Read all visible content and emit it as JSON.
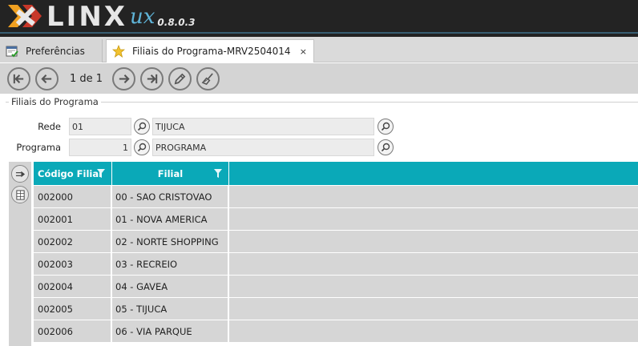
{
  "app": {
    "logo_text": "LINX",
    "logo_suffix": "ux",
    "version": "0.8.0.3"
  },
  "tabs": [
    {
      "label": "Preferências",
      "icon": "calendar-check-icon",
      "active": false
    },
    {
      "label": "Filiais do Programa-MRV2504014",
      "icon": "star-icon",
      "active": true,
      "close": "×"
    }
  ],
  "toolbar": {
    "pager": "1 de 1",
    "buttons": [
      "first-page-icon",
      "previous-page-icon",
      "next-page-icon",
      "last-page-icon",
      "edit-pencil-icon",
      "clear-broom-icon"
    ]
  },
  "form": {
    "section_title": "Filiais do Programa",
    "rede": {
      "label": "Rede",
      "code": "01",
      "description": "TIJUCA"
    },
    "programa": {
      "label": "Programa",
      "code": "1",
      "description": "PROGRAMA"
    }
  },
  "grid": {
    "columns": [
      "Código Filial",
      "Filial"
    ],
    "rows": [
      {
        "codigo": "002000",
        "filial": "00 - SAO CRISTOVAO"
      },
      {
        "codigo": "002001",
        "filial": "01 - NOVA AMERICA"
      },
      {
        "codigo": "002002",
        "filial": "02 - NORTE SHOPPING"
      },
      {
        "codigo": "002003",
        "filial": "03 - RECREIO"
      },
      {
        "codigo": "002004",
        "filial": "04 - GAVEA"
      },
      {
        "codigo": "002005",
        "filial": "05 - TIJUCA"
      },
      {
        "codigo": "002006",
        "filial": "06 - VIA PARQUE"
      }
    ]
  },
  "colors": {
    "header_bg": "#232323",
    "grid_header": "#0aa9b8",
    "logo_accent": "#5fb4d8",
    "row_bg": "#d6d6d6"
  }
}
